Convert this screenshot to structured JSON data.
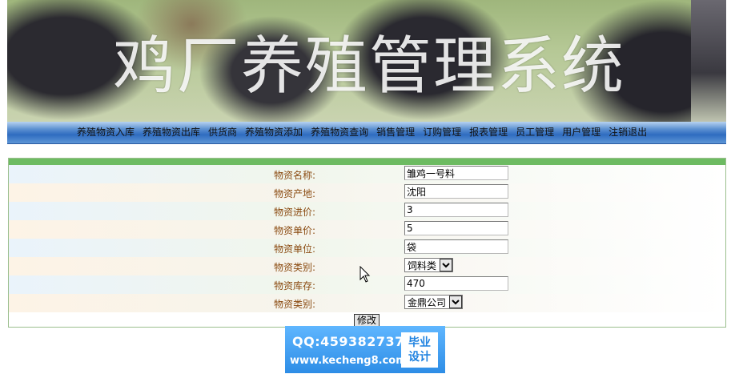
{
  "banner": {
    "title": "鸡厂养殖管理系统"
  },
  "nav": {
    "items": [
      "养殖物资入库",
      "养殖物资出库",
      "供货商",
      "养殖物资添加",
      "养殖物资查询",
      "销售管理",
      "订购管理",
      "报表管理",
      "员工管理",
      "用户管理",
      "注销退出"
    ]
  },
  "form": {
    "fields": [
      {
        "label": "物资名称:",
        "value": "雏鸡一号料"
      },
      {
        "label": "物资产地:",
        "value": "沈阳"
      },
      {
        "label": "物资进价:",
        "value": "3"
      },
      {
        "label": "物资单价:",
        "value": "5"
      },
      {
        "label": "物资单位:",
        "value": "袋"
      },
      {
        "label": "物资类别:",
        "selected": "饲料类"
      },
      {
        "label": "物资库存:",
        "value": "470"
      },
      {
        "label": "物资类别:",
        "selected": "金鼎公司"
      }
    ],
    "submit_label": "修改"
  },
  "watermark": {
    "qq": "QQ:459382737",
    "url": "www.kecheng8.com",
    "tag_line1": "毕业",
    "tag_line2": "设计"
  },
  "colors": {
    "nav_blue": "#2f6cc0",
    "panel_green": "#6dbb62",
    "label_brown": "#8a4a10"
  }
}
